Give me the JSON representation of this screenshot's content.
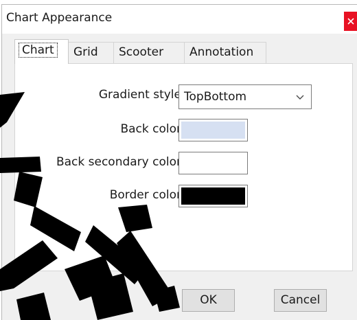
{
  "window": {
    "title": "Chart Appearance"
  },
  "tabs": [
    {
      "label": "Chart",
      "active": true
    },
    {
      "label": "Grid",
      "active": false
    },
    {
      "label": "Scooter",
      "active": false
    },
    {
      "label": "Annotation",
      "active": false
    }
  ],
  "form": {
    "gradient_style": {
      "label": "Gradient style",
      "value": "TopBottom"
    },
    "back_color": {
      "label": "Back color",
      "color": "#d6e0f2"
    },
    "back_secondary_color": {
      "label": "Back secondary color",
      "color": "#ffffff"
    },
    "border_color": {
      "label": "Border color",
      "color": "#000000"
    }
  },
  "buttons": {
    "ok": "OK",
    "cancel": "Cancel"
  },
  "icons": {
    "close": "close-icon",
    "dropdown": "chevron-down-icon"
  },
  "colors": {
    "close_button": "#e81123",
    "dialog_bg": "#f0f0f0",
    "watermark": "#000000"
  }
}
